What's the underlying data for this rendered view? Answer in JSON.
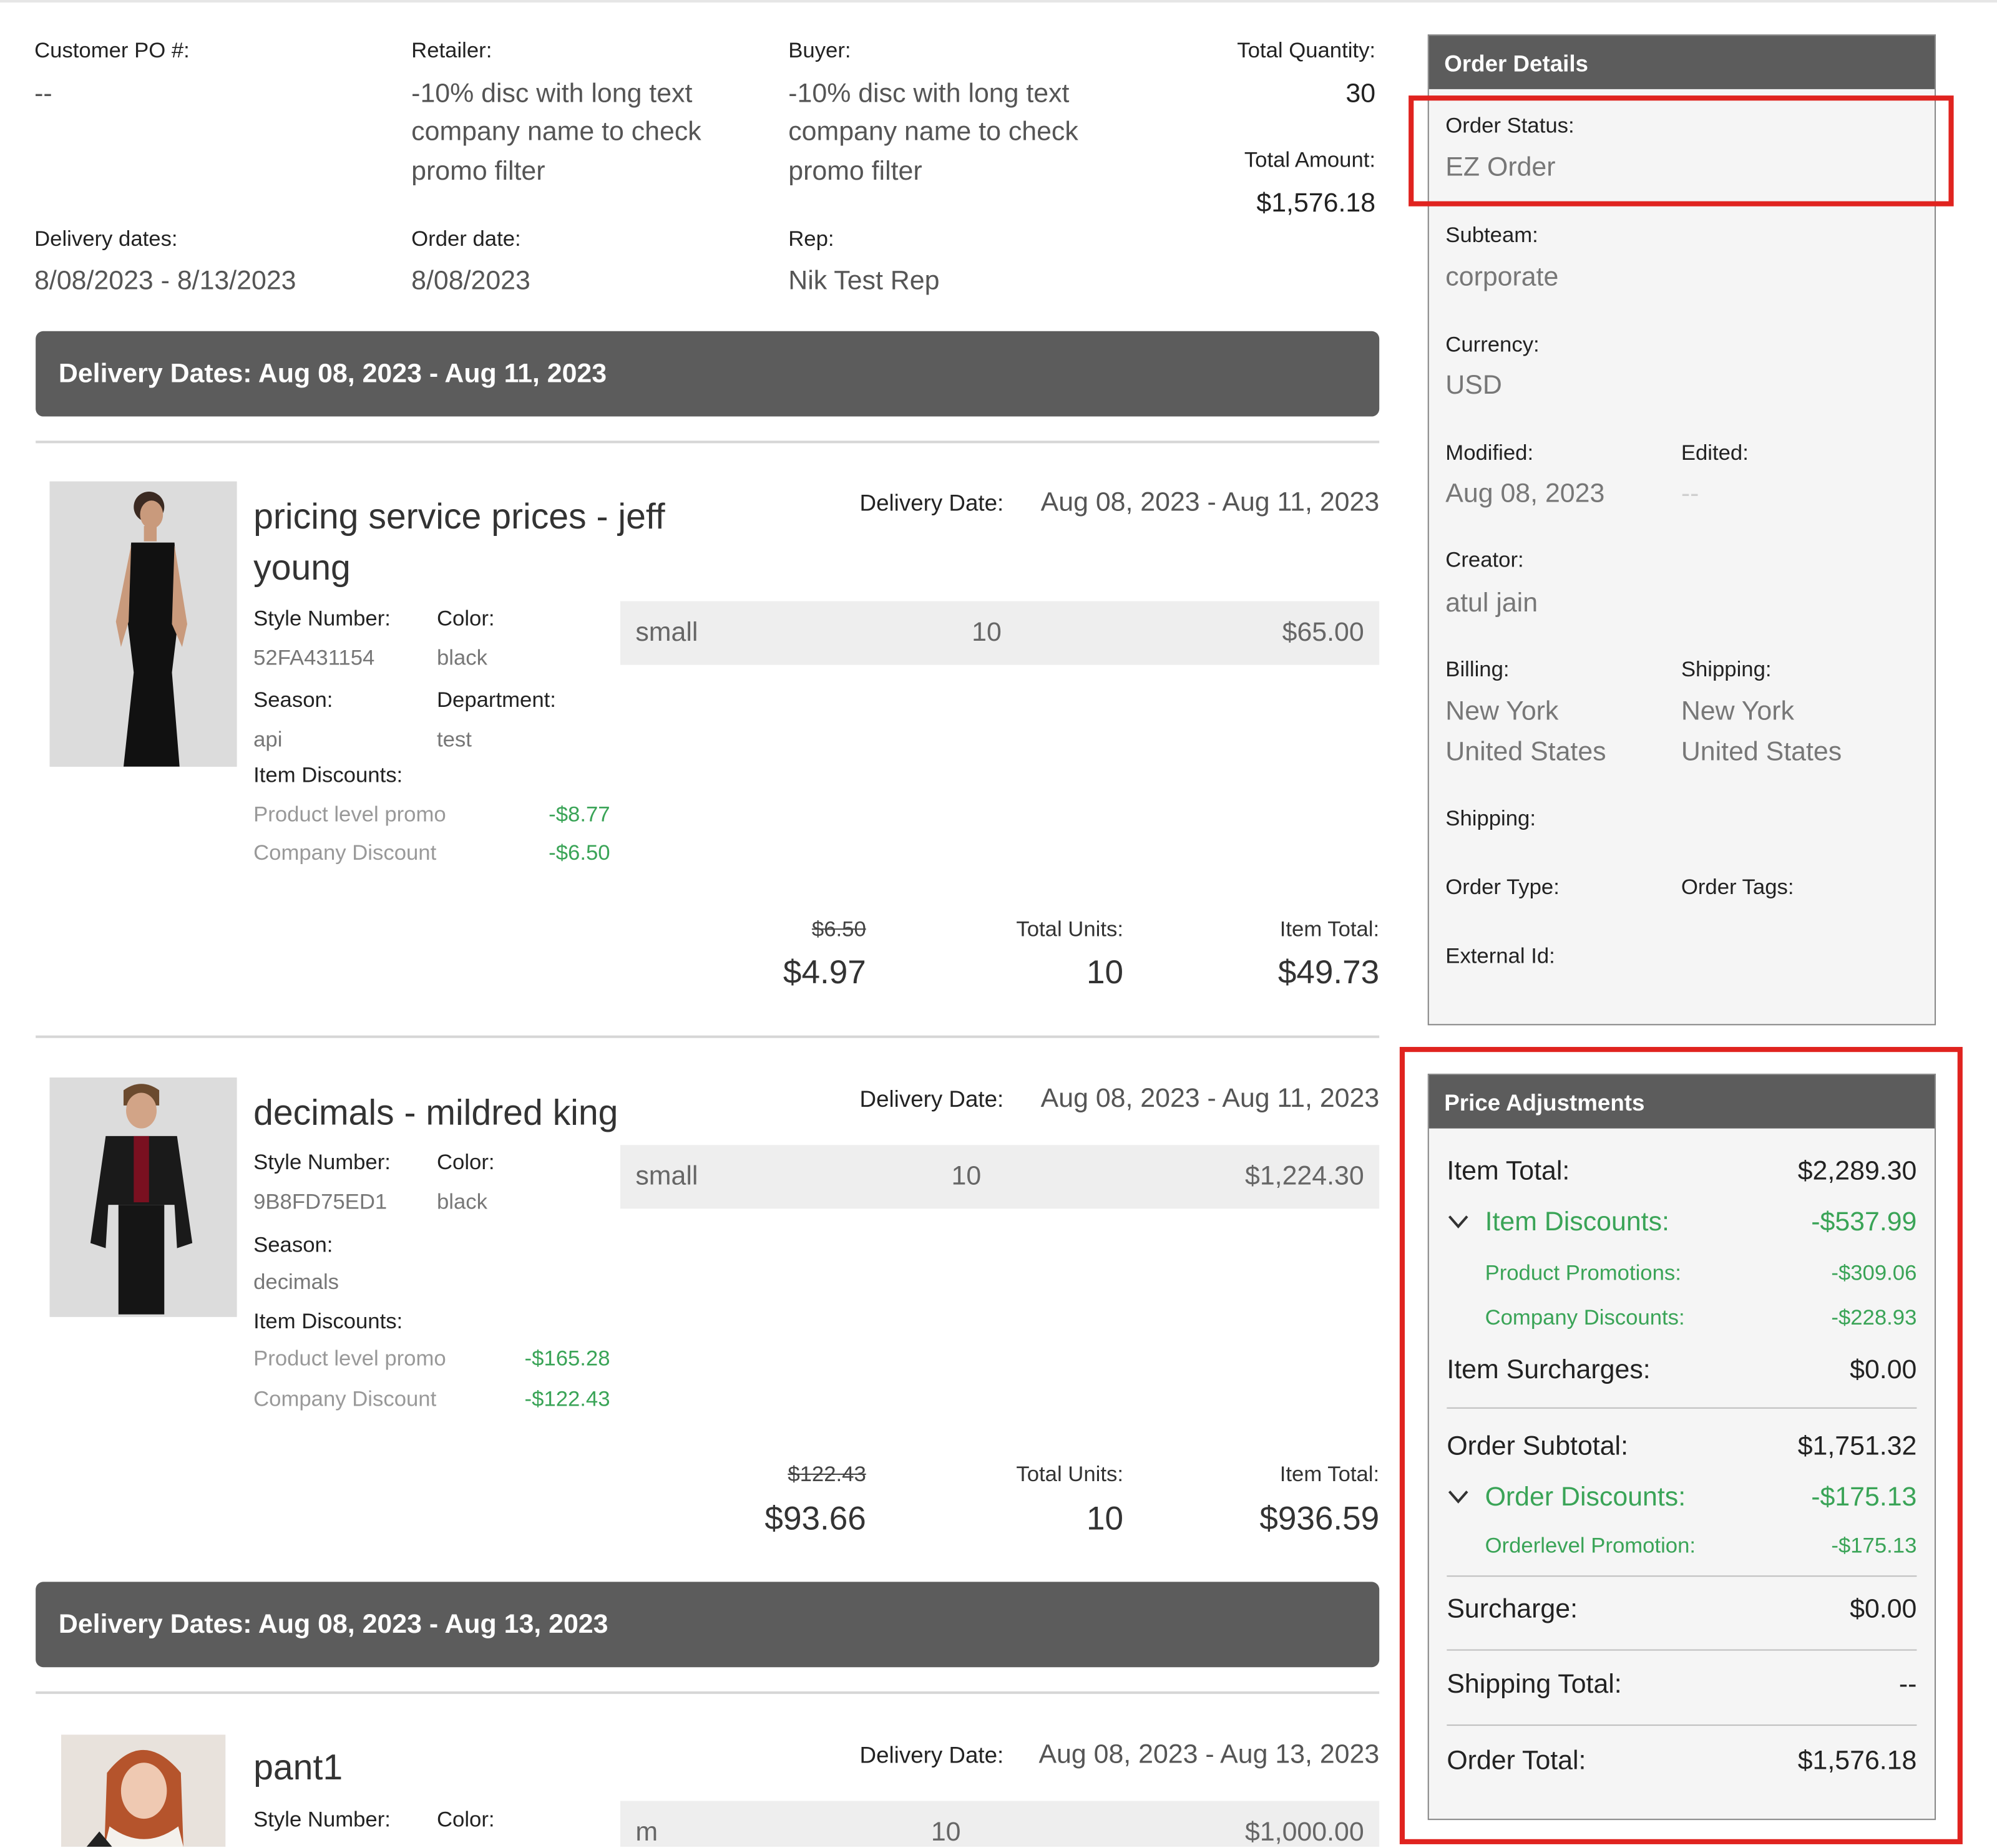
{
  "header": {
    "customer_po_label": "Customer PO #:",
    "customer_po_value": "--",
    "retailer_label": "Retailer:",
    "retailer_value_lines": [
      "-10% disc with long text",
      "company name to check",
      "promo filter"
    ],
    "buyer_label": "Buyer:",
    "buyer_value_lines": [
      "-10% disc with long text",
      "company name to check",
      "promo filter"
    ],
    "total_quantity_label": "Total Quantity:",
    "total_quantity_value": "30",
    "total_amount_label": "Total Amount:",
    "total_amount_value": "$1,576.18",
    "delivery_dates_label": "Delivery dates:",
    "delivery_dates_value": "8/08/2023 - 8/13/2023",
    "order_date_label": "Order date:",
    "order_date_value": "8/08/2023",
    "rep_label": "Rep:",
    "rep_value": "Nik Test Rep"
  },
  "groups": [
    {
      "title": "Delivery Dates: Aug 08, 2023 - Aug 11, 2023"
    },
    {
      "title": "Delivery Dates: Aug 08, 2023 - Aug 13, 2023"
    }
  ],
  "items": [
    {
      "name_lines": [
        "pricing service prices - jeff",
        "young"
      ],
      "delivery_date_label": "Delivery Date:",
      "delivery_date_value": "Aug 08, 2023 - Aug 11, 2023",
      "style_label": "Style Number:",
      "style_value": "52FA431154",
      "color_label": "Color:",
      "color_value": "black",
      "season_label": "Season:",
      "season_value": "api",
      "department_label": "Department:",
      "department_value": "test",
      "discounts_label": "Item Discounts:",
      "discounts": [
        {
          "label": "Product level promo",
          "value": "-$8.77"
        },
        {
          "label": "Company Discount",
          "value": "-$6.50"
        }
      ],
      "size": {
        "name": "small",
        "qty": "10",
        "price": "$65.00"
      },
      "original_price": "$6.50",
      "unit_price": "$4.97",
      "total_units_label": "Total Units:",
      "total_units": "10",
      "item_total_label": "Item Total:",
      "item_total": "$49.73"
    },
    {
      "name_lines": [
        "decimals - mildred king"
      ],
      "delivery_date_label": "Delivery Date:",
      "delivery_date_value": "Aug 08, 2023 - Aug 11, 2023",
      "style_label": "Style Number:",
      "style_value": "9B8FD75ED1",
      "color_label": "Color:",
      "color_value": "black",
      "season_label": "Season:",
      "season_value": "decimals",
      "discounts_label": "Item Discounts:",
      "discounts": [
        {
          "label": "Product level promo",
          "value": "-$165.28"
        },
        {
          "label": "Company Discount",
          "value": "-$122.43"
        }
      ],
      "size": {
        "name": "small",
        "qty": "10",
        "price": "$1,224.30"
      },
      "original_price": "$122.43",
      "unit_price": "$93.66",
      "total_units_label": "Total Units:",
      "total_units": "10",
      "item_total_label": "Item Total:",
      "item_total": "$936.59"
    },
    {
      "name_lines": [
        "pant1"
      ],
      "delivery_date_label": "Delivery Date:",
      "delivery_date_value": "Aug 08, 2023 - Aug 13, 2023",
      "style_label": "Style Number:",
      "color_label": "Color:",
      "size": {
        "name": "m",
        "qty": "10",
        "price": "$1,000.00"
      }
    }
  ],
  "order_details": {
    "title": "Order Details",
    "status_label": "Order Status:",
    "status_value": "EZ Order",
    "subteam_label": "Subteam:",
    "subteam_value": "corporate",
    "currency_label": "Currency:",
    "currency_value": "USD",
    "modified_label": "Modified:",
    "modified_value": "Aug 08, 2023",
    "edited_label": "Edited:",
    "edited_value": "--",
    "creator_label": "Creator:",
    "creator_value": "atul jain",
    "billing_label": "Billing:",
    "billing_lines": [
      "New York",
      "United States"
    ],
    "shipping_addr_label": "Shipping:",
    "shipping_addr_lines": [
      "New York",
      "United States"
    ],
    "shipping_label": "Shipping:",
    "order_type_label": "Order Type:",
    "order_tags_label": "Order Tags:",
    "external_id_label": "External Id:"
  },
  "price_adjustments": {
    "title": "Price Adjustments",
    "item_total_label": "Item Total:",
    "item_total_value": "$2,289.30",
    "item_discounts_label": "Item Discounts:",
    "item_discounts_value": "-$537.99",
    "product_promotions_label": "Product Promotions:",
    "product_promotions_value": "-$309.06",
    "company_discounts_label": "Company Discounts:",
    "company_discounts_value": "-$228.93",
    "item_surcharges_label": "Item Surcharges:",
    "item_surcharges_value": "$0.00",
    "order_subtotal_label": "Order Subtotal:",
    "order_subtotal_value": "$1,751.32",
    "order_discounts_label": "Order Discounts:",
    "order_discounts_value": "-$175.13",
    "orderlevel_promotion_label": "Orderlevel Promotion:",
    "orderlevel_promotion_value": "-$175.13",
    "surcharge_label": "Surcharge:",
    "surcharge_value": "$0.00",
    "shipping_total_label": "Shipping Total:",
    "shipping_total_value": "--",
    "order_total_label": "Order Total:",
    "order_total_value": "$1,576.18"
  },
  "colors": {
    "header_bar": "#5c5c5c",
    "discount_green": "#3aa457",
    "highlight_red": "#e0231f"
  }
}
